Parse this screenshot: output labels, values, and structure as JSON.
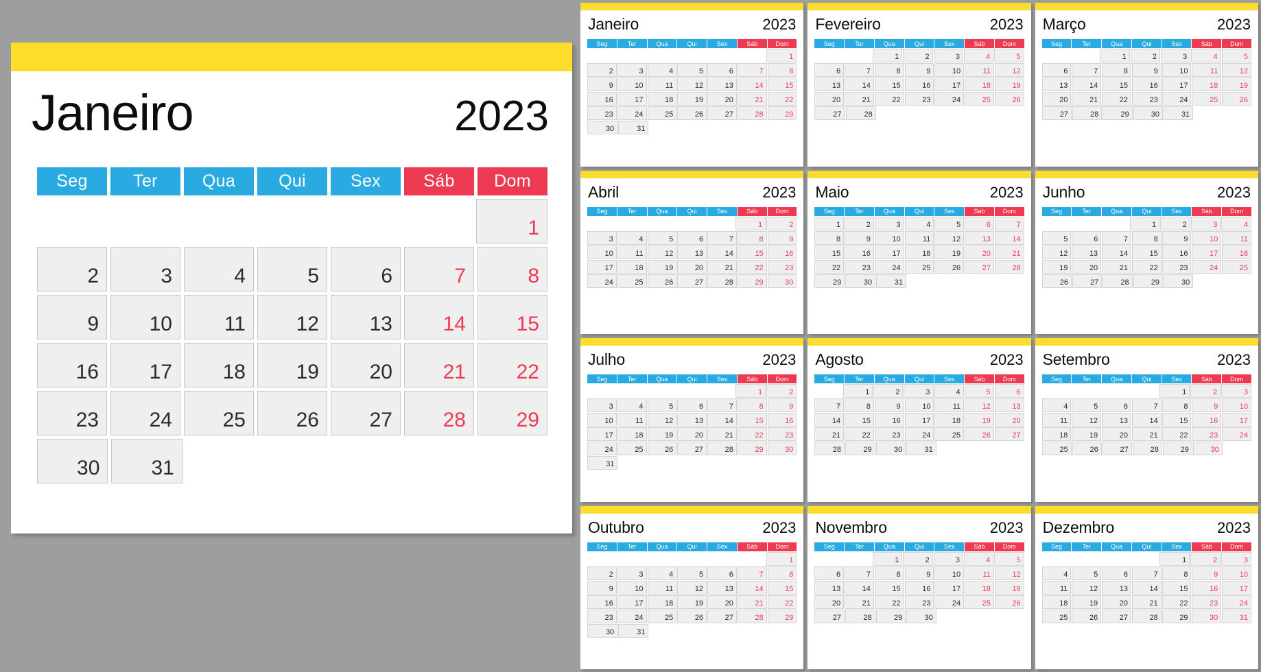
{
  "meta": {
    "year": "2023",
    "locale_language": "Portuguese",
    "week_starts_on": "Seg",
    "colors": {
      "page_background": "#9e9e9e",
      "card_background": "#ffffff",
      "accent_band": "#FCDD2B",
      "weekday_header": "#29ABE2",
      "weekend_header": "#ED3A52",
      "weekend_text": "#ED3A52",
      "day_cell": "#EFEFEF",
      "day_text": "#2b2b2b"
    }
  },
  "weekday_labels": [
    "Seg",
    "Ter",
    "Qua",
    "Qui",
    "Sex",
    "Sáb",
    "Dom"
  ],
  "weekend_columns": [
    5,
    6
  ],
  "featured": {
    "month": "Janeiro",
    "year": "2023",
    "weeks": [
      [
        "",
        "",
        "",
        "",
        "",
        "",
        "1"
      ],
      [
        "2",
        "3",
        "4",
        "5",
        "6",
        "7",
        "8"
      ],
      [
        "9",
        "10",
        "11",
        "12",
        "13",
        "14",
        "15"
      ],
      [
        "16",
        "17",
        "18",
        "19",
        "20",
        "21",
        "22"
      ],
      [
        "23",
        "24",
        "25",
        "26",
        "27",
        "28",
        "29"
      ],
      [
        "30",
        "31",
        "",
        "",
        "",
        "",
        ""
      ]
    ]
  },
  "months": [
    {
      "month": "Janeiro",
      "year": "2023",
      "weeks": [
        [
          "",
          "",
          "",
          "",
          "",
          "",
          "1"
        ],
        [
          "2",
          "3",
          "4",
          "5",
          "6",
          "7",
          "8"
        ],
        [
          "9",
          "10",
          "11",
          "12",
          "13",
          "14",
          "15"
        ],
        [
          "16",
          "17",
          "18",
          "19",
          "20",
          "21",
          "22"
        ],
        [
          "23",
          "24",
          "25",
          "26",
          "27",
          "28",
          "29"
        ],
        [
          "30",
          "31",
          "",
          "",
          "",
          "",
          ""
        ]
      ]
    },
    {
      "month": "Fevereiro",
      "year": "2023",
      "weeks": [
        [
          "",
          "",
          "1",
          "2",
          "3",
          "4",
          "5"
        ],
        [
          "6",
          "7",
          "8",
          "9",
          "10",
          "11",
          "12"
        ],
        [
          "13",
          "14",
          "15",
          "16",
          "17",
          "18",
          "19"
        ],
        [
          "20",
          "21",
          "22",
          "23",
          "24",
          "25",
          "26"
        ],
        [
          "27",
          "28",
          "",
          "",
          "",
          "",
          ""
        ],
        [
          "",
          "",
          "",
          "",
          "",
          "",
          ""
        ]
      ]
    },
    {
      "month": "Março",
      "year": "2023",
      "weeks": [
        [
          "",
          "",
          "1",
          "2",
          "3",
          "4",
          "5"
        ],
        [
          "6",
          "7",
          "8",
          "9",
          "10",
          "11",
          "12"
        ],
        [
          "13",
          "14",
          "15",
          "16",
          "17",
          "18",
          "19"
        ],
        [
          "20",
          "21",
          "22",
          "23",
          "24",
          "25",
          "26"
        ],
        [
          "27",
          "28",
          "29",
          "30",
          "31",
          "",
          ""
        ],
        [
          "",
          "",
          "",
          "",
          "",
          "",
          ""
        ]
      ]
    },
    {
      "month": "Abril",
      "year": "2023",
      "weeks": [
        [
          "",
          "",
          "",
          "",
          "",
          "1",
          "2"
        ],
        [
          "3",
          "4",
          "5",
          "6",
          "7",
          "8",
          "9"
        ],
        [
          "10",
          "11",
          "12",
          "13",
          "14",
          "15",
          "16"
        ],
        [
          "17",
          "18",
          "19",
          "20",
          "21",
          "22",
          "23"
        ],
        [
          "24",
          "25",
          "26",
          "27",
          "28",
          "29",
          "30"
        ],
        [
          "",
          "",
          "",
          "",
          "",
          "",
          ""
        ]
      ]
    },
    {
      "month": "Maio",
      "year": "2023",
      "weeks": [
        [
          "1",
          "2",
          "3",
          "4",
          "5",
          "6",
          "7"
        ],
        [
          "8",
          "9",
          "10",
          "11",
          "12",
          "13",
          "14"
        ],
        [
          "15",
          "16",
          "17",
          "18",
          "19",
          "20",
          "21"
        ],
        [
          "22",
          "23",
          "24",
          "25",
          "26",
          "27",
          "28"
        ],
        [
          "29",
          "30",
          "31",
          "",
          "",
          "",
          ""
        ],
        [
          "",
          "",
          "",
          "",
          "",
          "",
          ""
        ]
      ]
    },
    {
      "month": "Junho",
      "year": "2023",
      "weeks": [
        [
          "",
          "",
          "",
          "1",
          "2",
          "3",
          "4"
        ],
        [
          "5",
          "6",
          "7",
          "8",
          "9",
          "10",
          "11"
        ],
        [
          "12",
          "13",
          "14",
          "15",
          "16",
          "17",
          "18"
        ],
        [
          "19",
          "20",
          "21",
          "22",
          "23",
          "24",
          "25"
        ],
        [
          "26",
          "27",
          "28",
          "29",
          "30",
          "",
          ""
        ],
        [
          "",
          "",
          "",
          "",
          "",
          "",
          ""
        ]
      ]
    },
    {
      "month": "Julho",
      "year": "2023",
      "weeks": [
        [
          "",
          "",
          "",
          "",
          "",
          "1",
          "2"
        ],
        [
          "3",
          "4",
          "5",
          "6",
          "7",
          "8",
          "9"
        ],
        [
          "10",
          "11",
          "12",
          "13",
          "14",
          "15",
          "16"
        ],
        [
          "17",
          "18",
          "19",
          "20",
          "21",
          "22",
          "23"
        ],
        [
          "24",
          "25",
          "26",
          "27",
          "28",
          "29",
          "30"
        ],
        [
          "31",
          "",
          "",
          "",
          "",
          "",
          ""
        ]
      ]
    },
    {
      "month": "Agosto",
      "year": "2023",
      "weeks": [
        [
          "",
          "1",
          "2",
          "3",
          "4",
          "5",
          "6"
        ],
        [
          "7",
          "8",
          "9",
          "10",
          "11",
          "12",
          "13"
        ],
        [
          "14",
          "15",
          "16",
          "17",
          "18",
          "19",
          "20"
        ],
        [
          "21",
          "22",
          "23",
          "24",
          "25",
          "26",
          "27"
        ],
        [
          "28",
          "29",
          "30",
          "31",
          "",
          "",
          ""
        ],
        [
          "",
          "",
          "",
          "",
          "",
          "",
          ""
        ]
      ]
    },
    {
      "month": "Setembro",
      "year": "2023",
      "weeks": [
        [
          "",
          "",
          "",
          "",
          "1",
          "2",
          "3"
        ],
        [
          "4",
          "5",
          "6",
          "7",
          "8",
          "9",
          "10"
        ],
        [
          "11",
          "12",
          "13",
          "14",
          "15",
          "16",
          "17"
        ],
        [
          "18",
          "19",
          "20",
          "21",
          "22",
          "23",
          "24"
        ],
        [
          "25",
          "26",
          "27",
          "28",
          "29",
          "30",
          ""
        ],
        [
          "",
          "",
          "",
          "",
          "",
          "",
          ""
        ]
      ]
    },
    {
      "month": "Outubro",
      "year": "2023",
      "weeks": [
        [
          "",
          "",
          "",
          "",
          "",
          "",
          "1"
        ],
        [
          "2",
          "3",
          "4",
          "5",
          "6",
          "7",
          "8"
        ],
        [
          "9",
          "10",
          "11",
          "12",
          "13",
          "14",
          "15"
        ],
        [
          "16",
          "17",
          "18",
          "19",
          "20",
          "21",
          "22"
        ],
        [
          "23",
          "24",
          "25",
          "26",
          "27",
          "28",
          "29"
        ],
        [
          "30",
          "31",
          "",
          "",
          "",
          "",
          ""
        ]
      ]
    },
    {
      "month": "Novembro",
      "year": "2023",
      "weeks": [
        [
          "",
          "",
          "1",
          "2",
          "3",
          "4",
          "5"
        ],
        [
          "6",
          "7",
          "8",
          "9",
          "10",
          "11",
          "12"
        ],
        [
          "13",
          "14",
          "15",
          "16",
          "17",
          "18",
          "19"
        ],
        [
          "20",
          "21",
          "22",
          "23",
          "24",
          "25",
          "26"
        ],
        [
          "27",
          "28",
          "29",
          "30",
          "",
          "",
          ""
        ],
        [
          "",
          "",
          "",
          "",
          "",
          "",
          ""
        ]
      ]
    },
    {
      "month": "Dezembro",
      "year": "2023",
      "weeks": [
        [
          "",
          "",
          "",
          "",
          "1",
          "2",
          "3"
        ],
        [
          "4",
          "5",
          "6",
          "7",
          "8",
          "9",
          "10"
        ],
        [
          "11",
          "12",
          "13",
          "14",
          "15",
          "16",
          "17"
        ],
        [
          "18",
          "19",
          "20",
          "21",
          "22",
          "23",
          "24"
        ],
        [
          "25",
          "26",
          "27",
          "28",
          "29",
          "30",
          "31"
        ],
        [
          "",
          "",
          "",
          "",
          "",
          "",
          ""
        ]
      ]
    }
  ]
}
